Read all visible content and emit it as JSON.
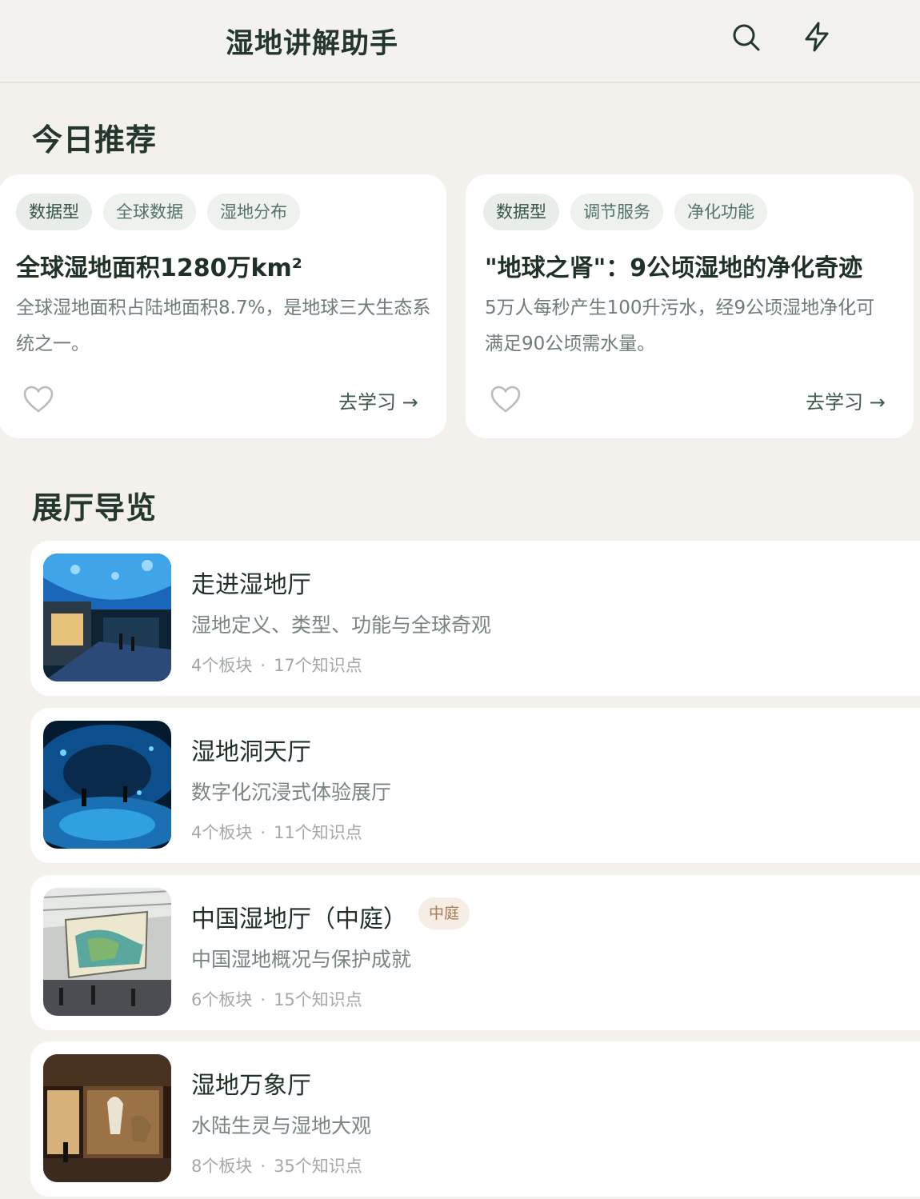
{
  "header": {
    "title": "湿地讲解助手",
    "search_icon": "search-icon",
    "flash_icon": "lightning-icon"
  },
  "today": {
    "title": "今日推荐",
    "cards": [
      {
        "tags": [
          "数据型",
          "全球数据",
          "湿地分布"
        ],
        "title": "全球湿地面积1280万km²",
        "desc": "全球湿地面积占陆地面积8.7%，是地球三大生态系统之一。",
        "action": "去学习 →"
      },
      {
        "tags": [
          "数据型",
          "调节服务",
          "净化功能"
        ],
        "title": "\"地球之肾\"：9公顷湿地的净化奇迹",
        "desc": "5万人每秒产生100升污水，经9公顷湿地净化可满足90公顷需水量。",
        "action": "去学习 →"
      }
    ]
  },
  "halls": {
    "title": "展厅导览",
    "items": [
      {
        "name": "走进湿地厅",
        "sub": "湿地定义、类型、功能与全球奇观",
        "blocks": "4个板块",
        "points": "17个知识点"
      },
      {
        "name": "湿地洞天厅",
        "sub": "数字化沉浸式体验展厅",
        "blocks": "4个板块",
        "points": "11个知识点"
      },
      {
        "name": "中国湿地厅（中庭）",
        "badge": "中庭",
        "sub": "中国湿地概况与保护成就",
        "blocks": "6个板块",
        "points": "15个知识点"
      },
      {
        "name": "湿地万象厅",
        "sub": "水陆生灵与湿地大观",
        "blocks": "8个板块",
        "points": "35个知识点"
      }
    ],
    "separator": "·"
  },
  "colors": {
    "background": "#f4f1ec",
    "card": "#ffffff",
    "primary_text": "#23372d",
    "accent": "#3d5a4b"
  }
}
